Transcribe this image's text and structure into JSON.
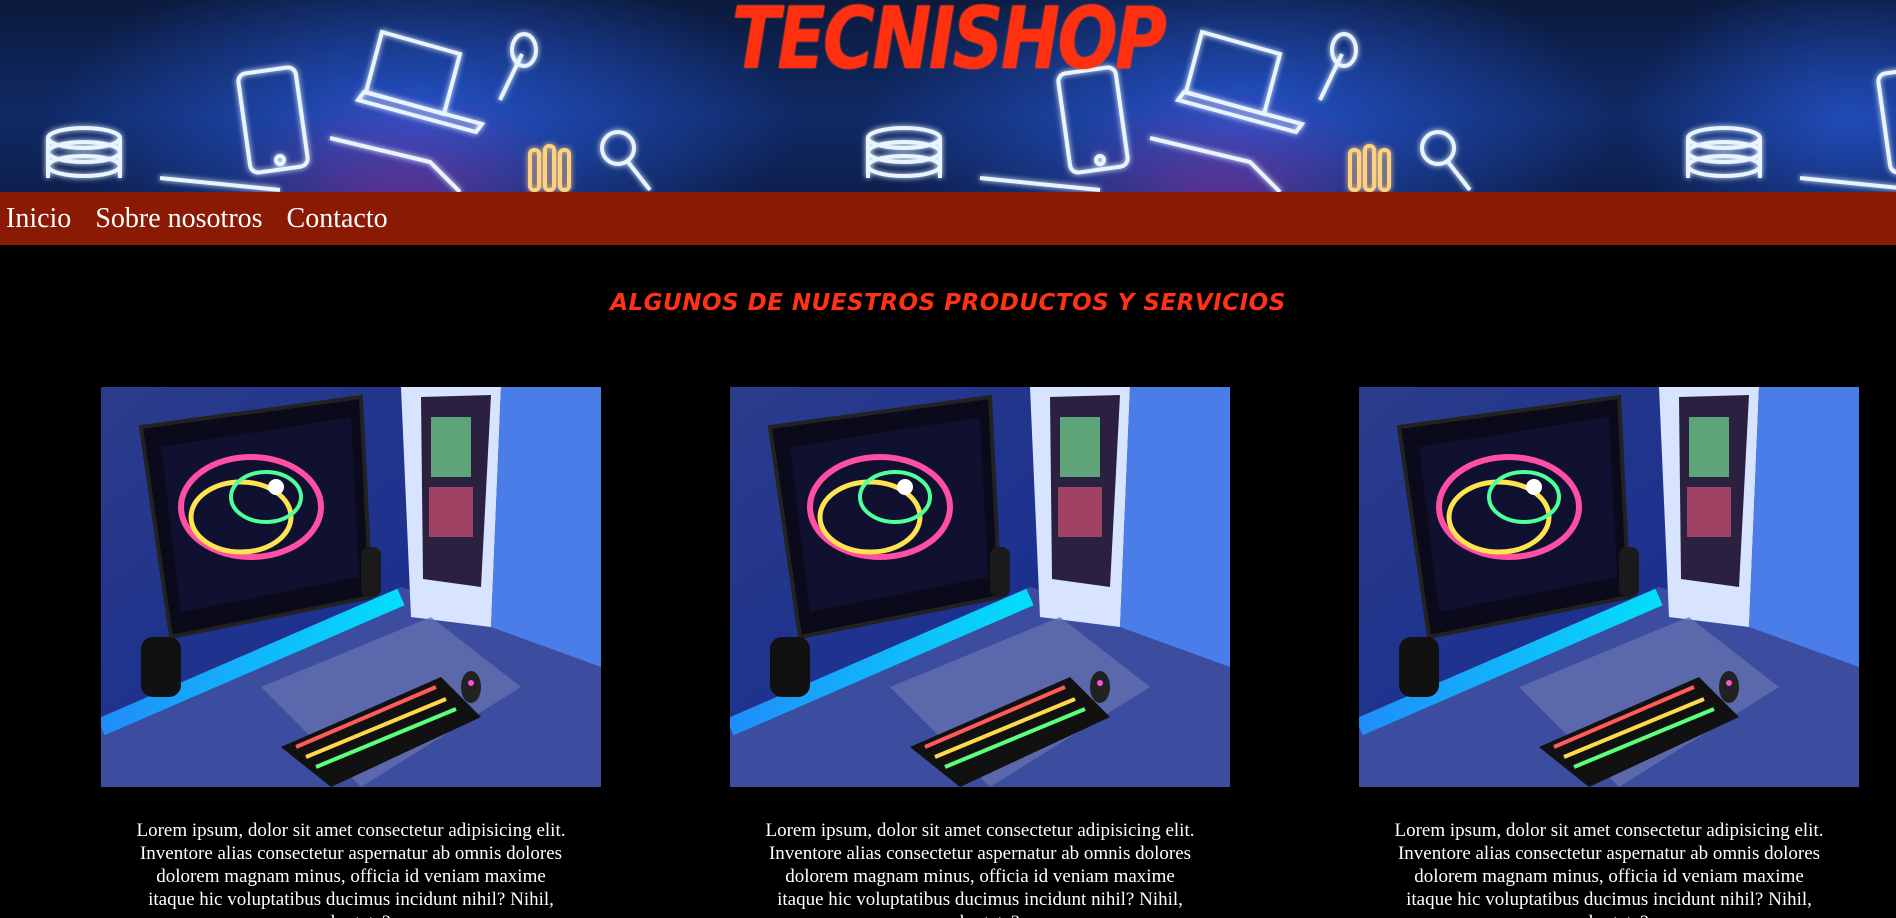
{
  "brand": {
    "name": "TECNISHOP"
  },
  "nav": {
    "items": [
      {
        "label": "Inicio"
      },
      {
        "label": "Sobre nosotros"
      },
      {
        "label": "Contacto"
      }
    ]
  },
  "section": {
    "title": "Algunos de nuestros productos y servicios"
  },
  "cards": [
    {
      "image": "gaming-setup-photo",
      "text": "Lorem ipsum, dolor sit amet consectetur adipisicing elit. Inventore alias consectetur aspernatur ab omnis dolores dolorem magnam minus, officia id veniam maxime itaque hic voluptatibus ducimus incidunt nihil? Nihil, voluptate?"
    },
    {
      "image": "gaming-setup-photo",
      "text": "Lorem ipsum, dolor sit amet consectetur adipisicing elit. Inventore alias consectetur aspernatur ab omnis dolores dolorem magnam minus, officia id veniam maxime itaque hic voluptatibus ducimus incidunt nihil? Nihil, voluptate?"
    },
    {
      "image": "gaming-setup-photo",
      "text": "Lorem ipsum, dolor sit amet consectetur adipisicing elit. Inventore alias consectetur aspernatur ab omnis dolores dolorem magnam minus, officia id veniam maxime itaque hic voluptatibus ducimus incidunt nihil? Nihil, voluptate?"
    }
  ],
  "colors": {
    "brand": "#ff3010",
    "nav_bg": "#8b1a05",
    "page_bg": "#000000",
    "section_title": "#ff3214"
  }
}
